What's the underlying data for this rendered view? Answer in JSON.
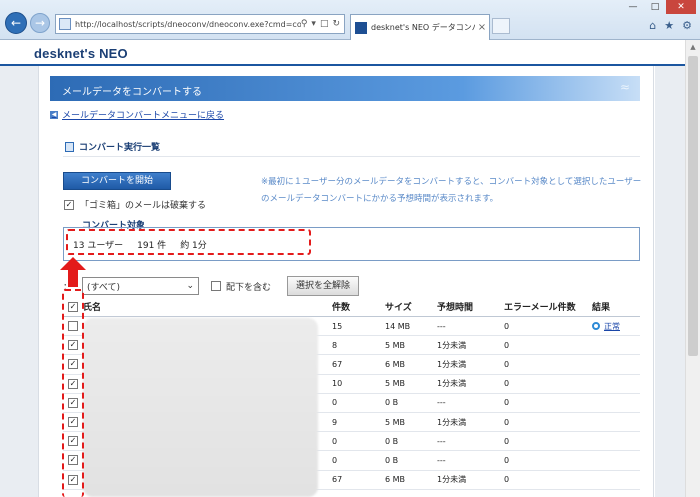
{
  "browser": {
    "url": "http://localhost/scripts/dneoconv/dneoconv.exe?cmd=co",
    "tab_title": "desknet's NEO データコンバ...",
    "tab_close": "×",
    "min_glyph": "—",
    "max_glyph": "□",
    "close_glyph": "✕"
  },
  "app": {
    "logo": "desknet's NEO"
  },
  "page": {
    "title": "メールデータをコンバートする",
    "back_link": "メールデータコンバートメニューに戻る",
    "section_title": "コンバート実行一覧",
    "convert_button": "コンバートを開始",
    "trash_option": "「ゴミ箱」のメールは破棄する",
    "notice": "※最初に１ユーザー分のメールデータをコンバートすると、コンバート対象として選択したユーザーのメールデータコンバートにかかる予想時間が表示されます。",
    "target_label": "コンバート対象",
    "target_users": "13 ユーザー",
    "target_items": "191 件",
    "target_time": "約 1分"
  },
  "filter": {
    "prefix": "：",
    "selected": "(すべて)",
    "include_sub": "配下を含む",
    "clear_button": "選択を全解除"
  },
  "table": {
    "headers": {
      "name": "氏名",
      "count": "件数",
      "size": "サイズ",
      "time": "予想時間",
      "errors": "エラーメール件数",
      "result": "結果"
    },
    "rows": [
      {
        "count": "15",
        "size": "14 MB",
        "time": "---",
        "errors": "0",
        "result": "正常"
      },
      {
        "count": "8",
        "size": "5 MB",
        "time": "1分未満",
        "errors": "0",
        "result": ""
      },
      {
        "count": "67",
        "size": "6 MB",
        "time": "1分未満",
        "errors": "0",
        "result": ""
      },
      {
        "count": "10",
        "size": "5 MB",
        "time": "1分未満",
        "errors": "0",
        "result": ""
      },
      {
        "count": "0",
        "size": "0 B",
        "time": "---",
        "errors": "0",
        "result": ""
      },
      {
        "count": "9",
        "size": "5 MB",
        "time": "1分未満",
        "errors": "0",
        "result": ""
      },
      {
        "count": "0",
        "size": "0 B",
        "time": "---",
        "errors": "0",
        "result": ""
      },
      {
        "count": "0",
        "size": "0 B",
        "time": "---",
        "errors": "0",
        "result": ""
      },
      {
        "count": "67",
        "size": "6 MB",
        "time": "1分未満",
        "errors": "0",
        "result": ""
      }
    ]
  },
  "colors": {
    "accent": "#1b56a0",
    "annotation": "#e31b1b",
    "link": "#1a46a8"
  }
}
